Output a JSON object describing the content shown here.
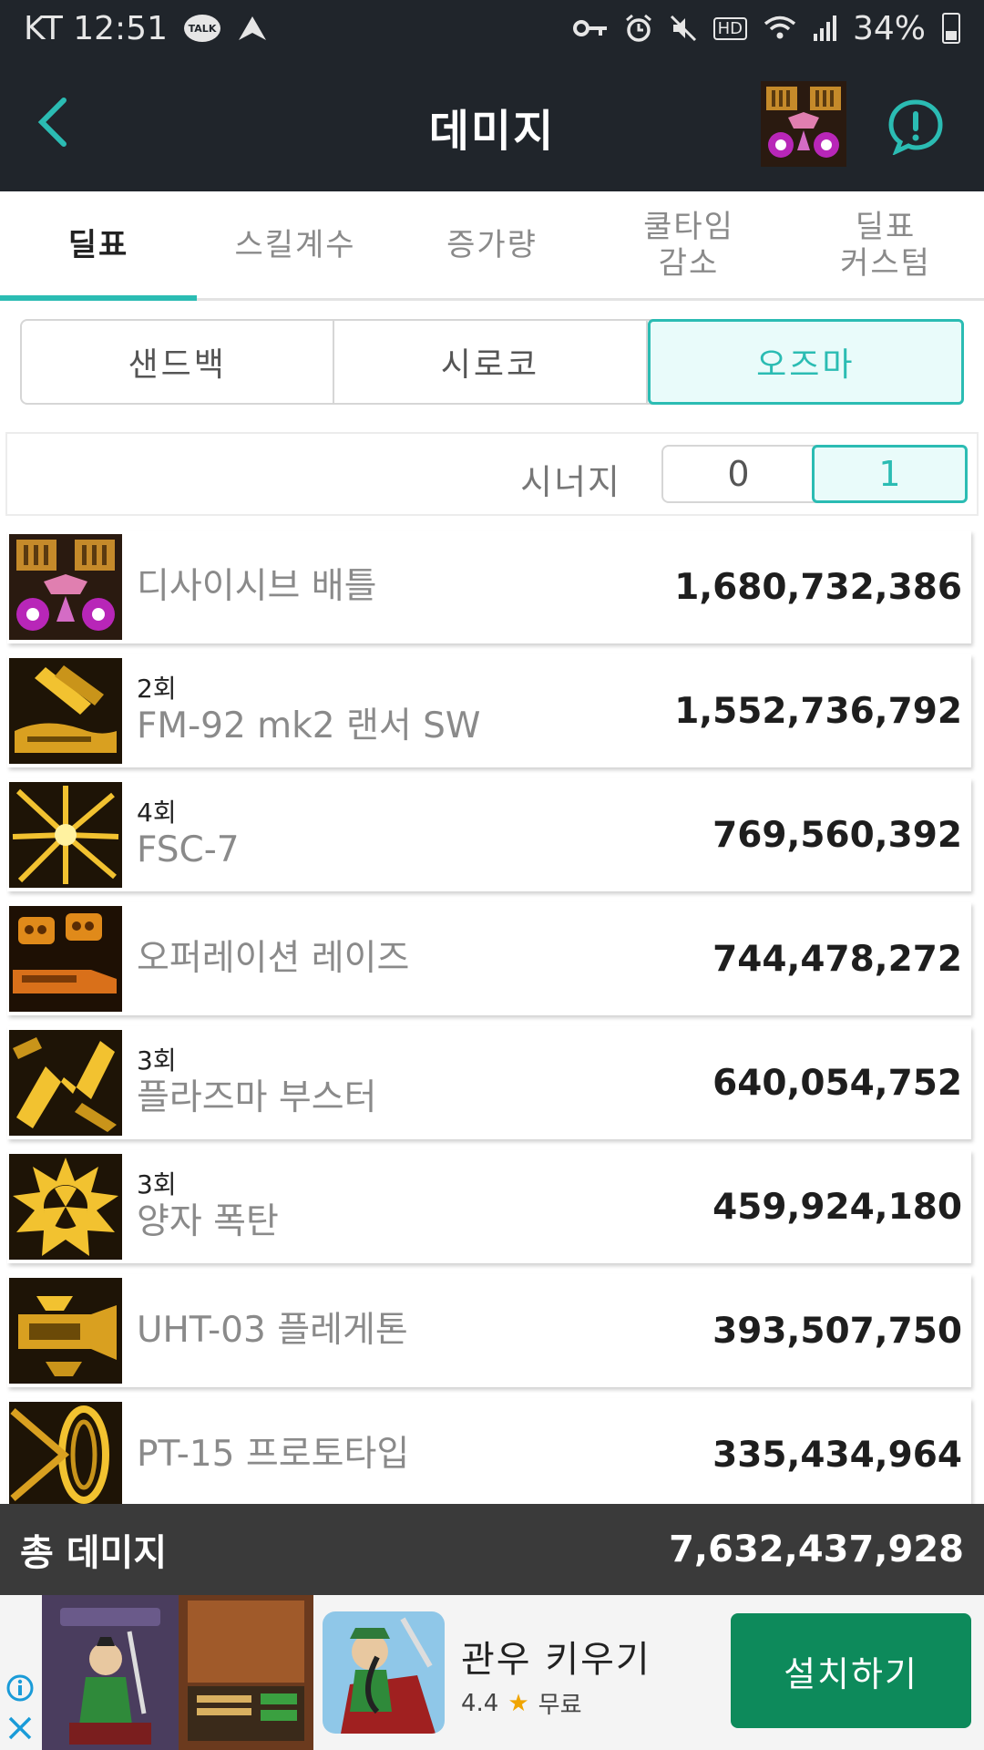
{
  "status_bar": {
    "carrier_time": "KT 12:51",
    "talk_label": "TALK",
    "hd_label": "HD",
    "battery": "34%"
  },
  "app_bar": {
    "title": "데미지"
  },
  "tabs": [
    {
      "label": "딜표",
      "active": true
    },
    {
      "label": "스킬계수",
      "active": false
    },
    {
      "label": "증가량",
      "active": false
    },
    {
      "label": "쿨타임\n감소",
      "active": false
    },
    {
      "label": "딜표\n커스텀",
      "active": false
    }
  ],
  "segments": [
    {
      "label": "샌드백",
      "active": false
    },
    {
      "label": "시로코",
      "active": false
    },
    {
      "label": "오즈마",
      "active": true
    }
  ],
  "synergy": {
    "label": "시너지",
    "options": [
      "0",
      "1"
    ],
    "selected": "1"
  },
  "skills": [
    {
      "hits": "",
      "name": "디사이시브 배틀",
      "damage": "1,680,732,386",
      "icon": "decisive-battle-icon"
    },
    {
      "hits": "2회",
      "name": "FM-92 mk2 랜서 SW",
      "damage": "1,552,736,792",
      "icon": "lancer-icon"
    },
    {
      "hits": "4회",
      "name": "FSC-7",
      "damage": "769,560,392",
      "icon": "fsc-icon"
    },
    {
      "hits": "",
      "name": "오퍼레이션 레이즈",
      "damage": "744,478,272",
      "icon": "operation-raise-icon"
    },
    {
      "hits": "3회",
      "name": "플라즈마 부스터",
      "damage": "640,054,752",
      "icon": "plasma-booster-icon"
    },
    {
      "hits": "3회",
      "name": "양자 폭탄",
      "damage": "459,924,180",
      "icon": "quantum-bomb-icon"
    },
    {
      "hits": "",
      "name": "UHT-03 플레게톤",
      "damage": "393,507,750",
      "icon": "phlegethon-icon"
    },
    {
      "hits": "",
      "name": "PT-15 프로토타입",
      "damage": "335,434,964",
      "icon": "prototype-icon"
    }
  ],
  "total": {
    "label": "총 데미지",
    "value": "7,632,437,928"
  },
  "ad": {
    "app_name": "관우 키우기",
    "rating": "4.4",
    "price": "무료",
    "install_label": "설치하기"
  },
  "colors": {
    "accent": "#2bbcb3",
    "bar_dark": "#20252b",
    "total_bar": "#3a3a3a",
    "install_green": "#0d8a5b"
  }
}
